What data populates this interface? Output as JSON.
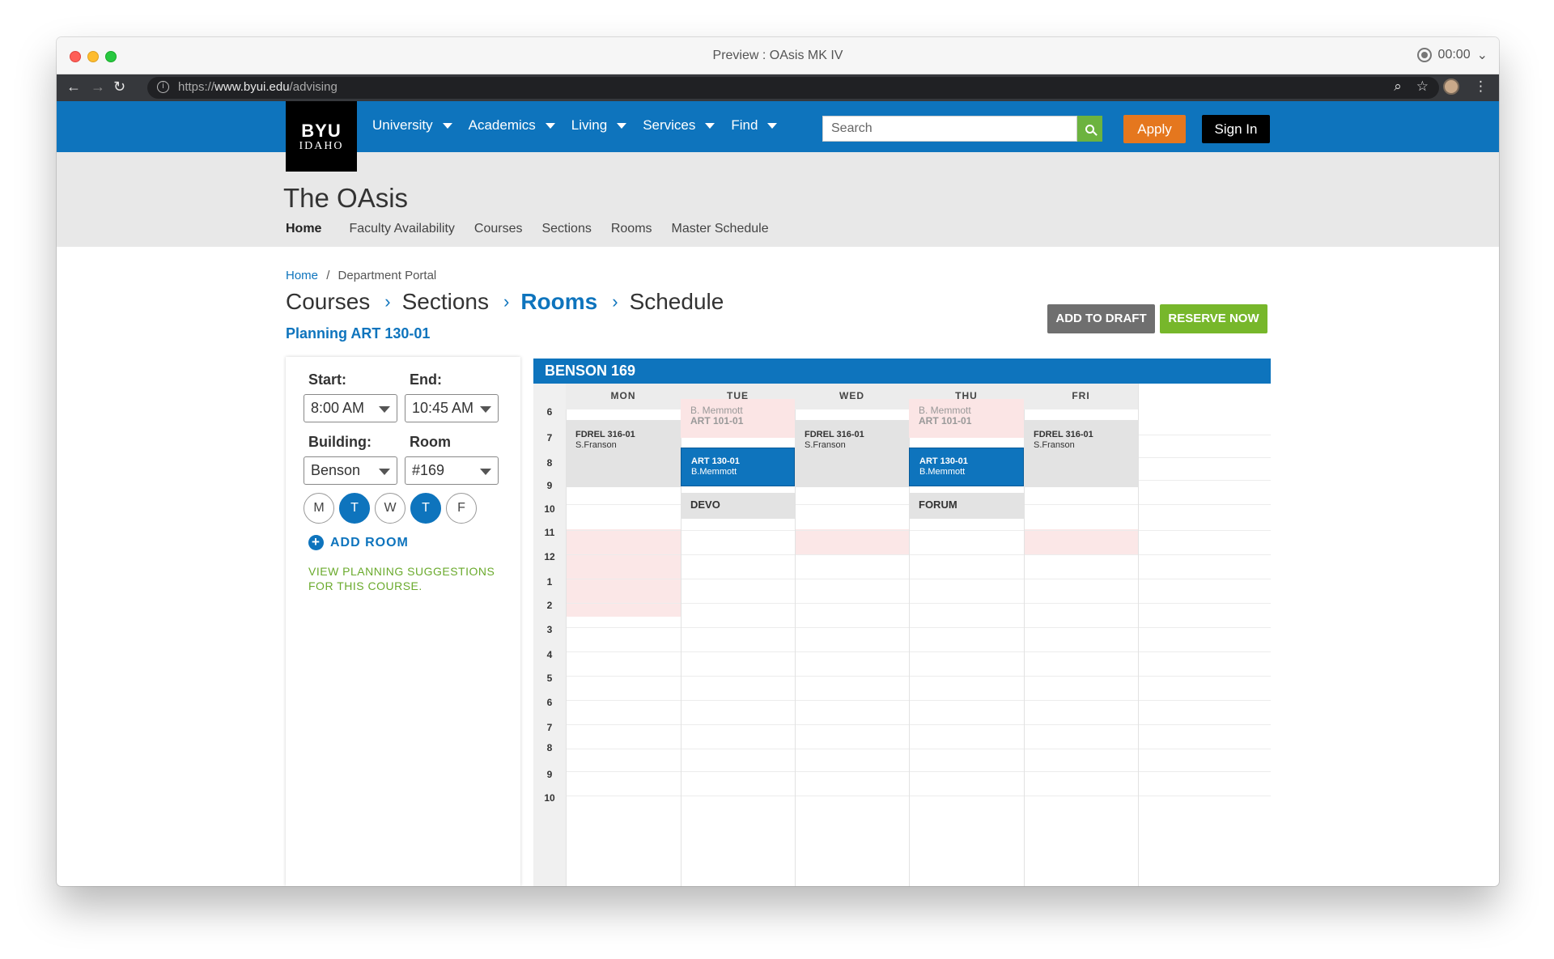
{
  "window": {
    "title": "Preview : OAsis MK IV",
    "recording_time": "00:00"
  },
  "browser": {
    "url_prefix": "https://",
    "url_domain": "www.byui.edu",
    "url_path": "/advising"
  },
  "site": {
    "logo_line1": "BYU",
    "logo_line2": "IDAHO",
    "nav": [
      "University",
      "Academics",
      "Living",
      "Services",
      "Find"
    ],
    "search_placeholder": "Search",
    "apply_label": "Apply",
    "signin_label": "Sign In"
  },
  "app": {
    "title": "The OAsis",
    "subnav": [
      "Home",
      "Faculty Availability",
      "Courses",
      "Sections",
      "Rooms",
      "Master Schedule"
    ]
  },
  "breadcrumb": {
    "home": "Home",
    "separator": "/",
    "current": "Department Portal"
  },
  "steps": [
    "Courses",
    "Sections",
    "Rooms",
    "Schedule"
  ],
  "steps_current": "Rooms",
  "planning_title": "Planning ART 130-01",
  "actions": {
    "draft": "ADD TO DRAFT",
    "reserve": "RESERVE NOW"
  },
  "panel": {
    "start_label": "Start:",
    "end_label": "End:",
    "start_value": "8:00 AM",
    "end_value": "10:45 AM",
    "building_label": "Building:",
    "room_label": "Room",
    "building_value": "Benson",
    "room_value": "#169",
    "days": [
      {
        "label": "M",
        "selected": false
      },
      {
        "label": "T",
        "selected": true
      },
      {
        "label": "W",
        "selected": false
      },
      {
        "label": "T",
        "selected": true
      },
      {
        "label": "F",
        "selected": false
      }
    ],
    "add_room": "ADD ROOM",
    "suggestions": "VIEW PLANNING SUGGESTIONS FOR THIS COURSE."
  },
  "calendar": {
    "room": "BENSON 169",
    "days": [
      "MON",
      "TUE",
      "WED",
      "THU",
      "FRI"
    ],
    "hours": [
      "6",
      "7",
      "8",
      "9",
      "10",
      "11",
      "12",
      "1",
      "2",
      "3",
      "4",
      "5",
      "6",
      "7",
      "8",
      "9",
      "10"
    ],
    "events": [
      {
        "day": "MON",
        "title": "FDREL 316-01",
        "sub": "S.Franson",
        "kind": "existing"
      },
      {
        "day": "WED",
        "title": "FDREL 316-01",
        "sub": "S.Franson",
        "kind": "existing"
      },
      {
        "day": "FRI",
        "title": "FDREL 316-01",
        "sub": "S.Franson",
        "kind": "existing"
      },
      {
        "day": "TUE",
        "title": "B. Memmott",
        "sub": "ART 101-01",
        "kind": "conflict"
      },
      {
        "day": "THU",
        "title": "B. Memmott",
        "sub": "ART 101-01",
        "kind": "conflict"
      },
      {
        "day": "TUE",
        "title": "ART 130-01",
        "sub": "B.Memmott",
        "kind": "planned"
      },
      {
        "day": "THU",
        "title": "ART 130-01",
        "sub": "B.Memmott",
        "kind": "planned"
      },
      {
        "day": "TUE",
        "title": "DEVO",
        "kind": "label"
      },
      {
        "day": "THU",
        "title": "FORUM",
        "kind": "label"
      }
    ]
  },
  "colors": {
    "brand_blue": "#0e74bd",
    "apply_orange": "#e5771e",
    "reserve_green": "#77b72b",
    "draft_gray": "#6f6f6f"
  }
}
